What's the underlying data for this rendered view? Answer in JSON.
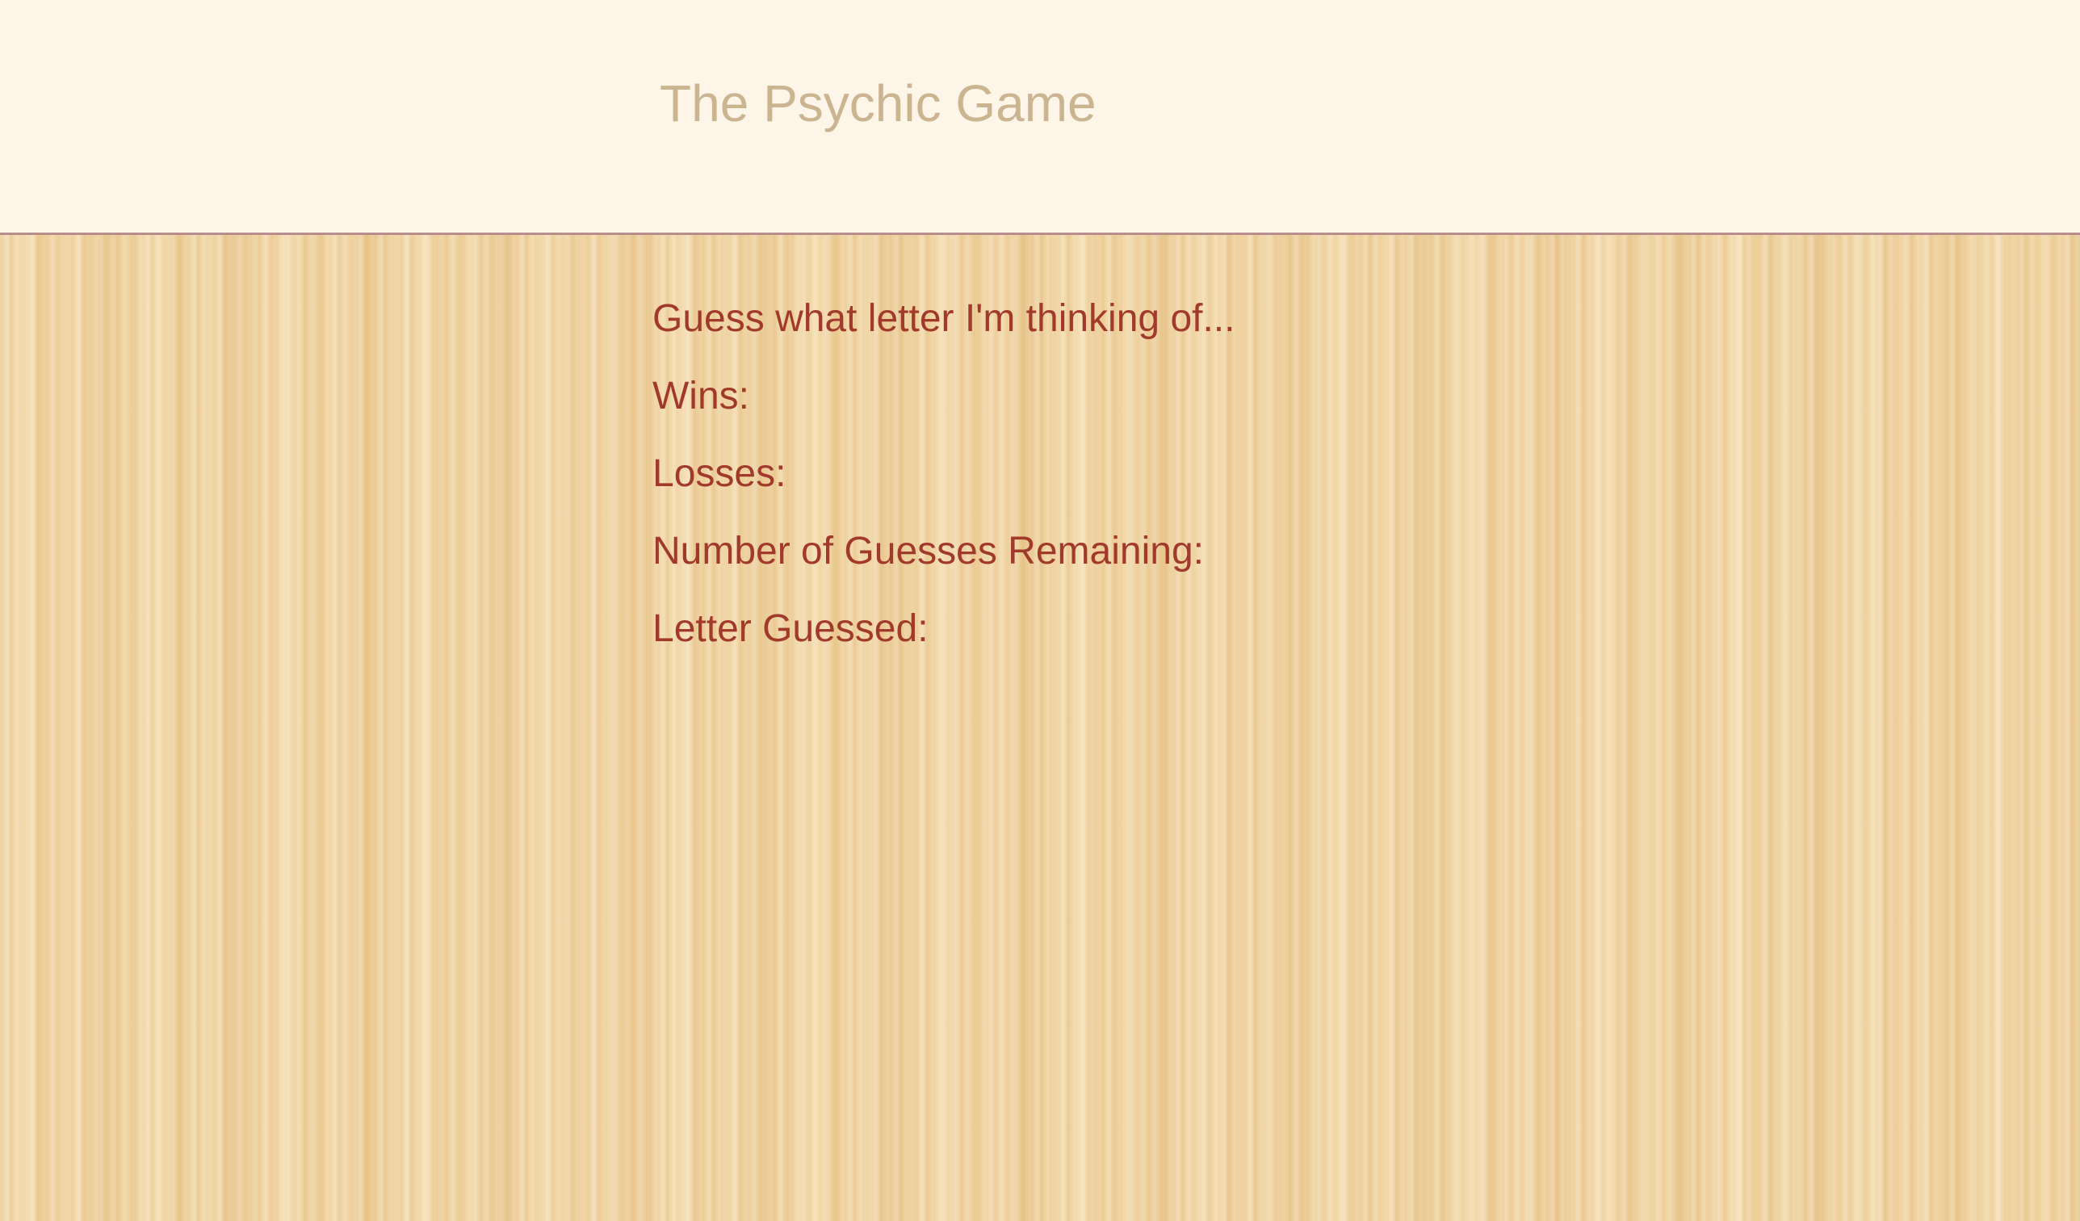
{
  "header": {
    "title": "The Psychic Game"
  },
  "game": {
    "prompt": "Guess what letter I'm thinking of...",
    "wins_label": "Wins:",
    "wins_value": "",
    "losses_label": "Losses:",
    "losses_value": "",
    "guesses_remaining_label": "Number of Guesses Remaining:",
    "guesses_remaining_value": "",
    "letters_guessed_label": "Letter Guessed:",
    "letters_guessed_value": ""
  },
  "colors": {
    "header_background": "#fdf5e8",
    "title_text": "#cbb591",
    "body_text": "#a23a2b",
    "header_border": "#b88d8d",
    "wood_background": "#f1d6a5"
  }
}
